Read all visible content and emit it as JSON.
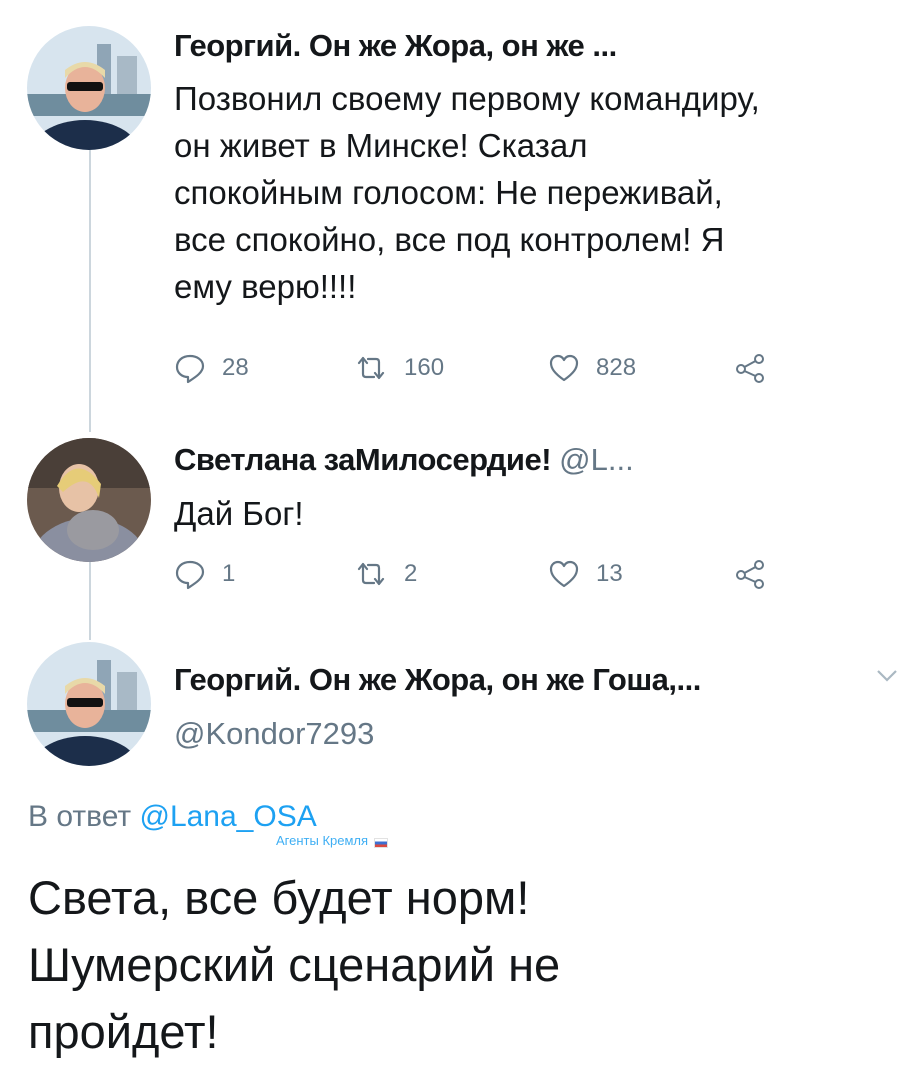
{
  "tweet1": {
    "author": "Георгий. Он же Жора, он же ...",
    "text": "Позвонил своему первому командиру,\nон живет в Минске! Сказал\nспокойным голосом: Не переживай,\nвсе спокойно, все под контролем! Я\nему верю!!!!",
    "replies": "28",
    "retweets": "160",
    "likes": "828"
  },
  "tweet2": {
    "author": "Светлана заМилосердие!",
    "handle": "@L...",
    "text": "Дай Бог!",
    "replies": "1",
    "retweets": "2",
    "likes": "13"
  },
  "tweet3": {
    "author": "Георгий. Он же Жора, он же Гоша,...",
    "handle": "@Kondor7293",
    "reply_prefix": "В ответ",
    "reply_mention": "@Lana_OSA",
    "text": "Света, все будет норм!\nШумерский сценарий не\nпройдет!"
  },
  "watermark": "Агенты Кремля",
  "icons": [
    "reply-icon",
    "retweet-icon",
    "like-icon",
    "share-icon",
    "chevron-down-icon"
  ],
  "colors": {
    "secondary": "#657786",
    "link": "#1da1f2",
    "thread_line": "#ccd6dd"
  }
}
